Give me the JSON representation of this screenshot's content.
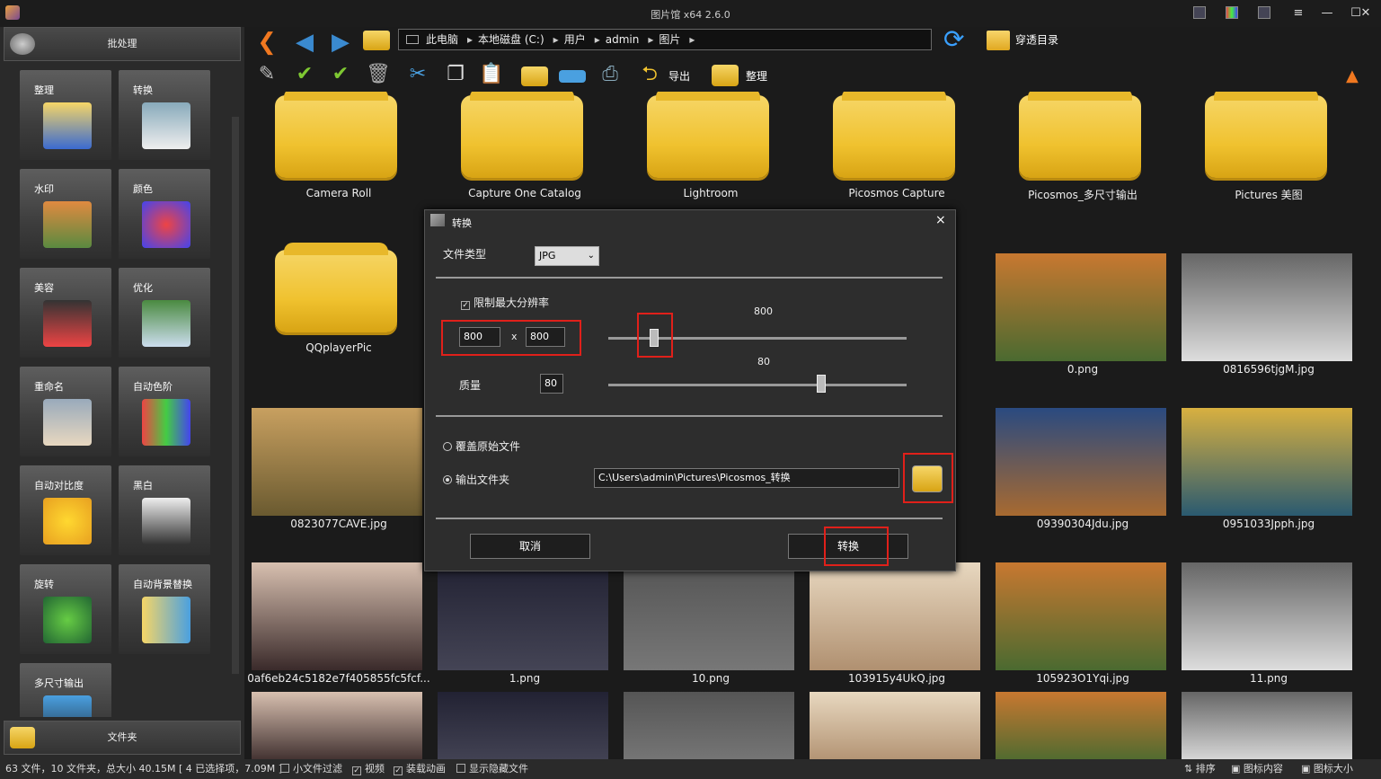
{
  "window": {
    "title": "图片馆 x64 2.6.0",
    "minimize": "—",
    "maximize": "☐",
    "close": "✕"
  },
  "sidebar": {
    "header": "批处理",
    "footer": "文件夹",
    "tiles": [
      {
        "label": "整理",
        "icon": "organize-icon"
      },
      {
        "label": "转换",
        "icon": "convert-icon"
      },
      {
        "label": "水印",
        "icon": "watermark-icon"
      },
      {
        "label": "颜色",
        "icon": "color-icon"
      },
      {
        "label": "美容",
        "icon": "beauty-icon"
      },
      {
        "label": "优化",
        "icon": "optimize-icon"
      },
      {
        "label": "重命名",
        "icon": "rename-icon"
      },
      {
        "label": "自动色阶",
        "icon": "auto-levels-icon"
      },
      {
        "label": "自动对比度",
        "icon": "auto-contrast-icon"
      },
      {
        "label": "黑白",
        "icon": "black-white-icon"
      },
      {
        "label": "旋转",
        "icon": "rotate-icon"
      },
      {
        "label": "自动背景替换",
        "icon": "background-replace-icon"
      },
      {
        "label": "多尺寸输出",
        "icon": "multi-size-icon"
      }
    ]
  },
  "address": {
    "crumbs": [
      "此电脑",
      "本地磁盘 (C:)",
      "用户",
      "admin",
      "图片"
    ],
    "separator": "▸",
    "penetrate_label": "穿透目录"
  },
  "toolbar": {
    "export_label": "导出",
    "organize_label": "整理"
  },
  "grid": [
    {
      "name": "Camera Roll",
      "kind": "folder"
    },
    {
      "name": "Capture One Catalog",
      "kind": "folder"
    },
    {
      "name": "Lightroom",
      "kind": "folder"
    },
    {
      "name": "Picosmos Capture",
      "kind": "folder"
    },
    {
      "name": "Picosmos_多尺寸输出",
      "kind": "folder"
    },
    {
      "name": "Pictures 美图",
      "kind": "folder"
    },
    {
      "name": "QQplayerPic",
      "kind": "folder"
    },
    {
      "name": "0.png",
      "kind": "image"
    },
    {
      "name": "0816596tjgM.jpg",
      "kind": "image"
    },
    {
      "name": "0823077CAVE.jpg",
      "kind": "image"
    },
    {
      "name": "09390304Jdu.jpg",
      "kind": "image"
    },
    {
      "name": "0951033Jpph.jpg",
      "kind": "image"
    },
    {
      "name": "0af6eb24c5182e7f405855fc5fcf...",
      "kind": "image"
    },
    {
      "name": "1.png",
      "kind": "image"
    },
    {
      "name": "10.png",
      "kind": "image"
    },
    {
      "name": "103915y4UkQ.jpg",
      "kind": "image"
    },
    {
      "name": "105923O1Yqi.jpg",
      "kind": "image"
    },
    {
      "name": "11.png",
      "kind": "image"
    }
  ],
  "dialog": {
    "title": "转换",
    "file_type_label": "文件类型",
    "file_type_value": "JPG",
    "limit_res_label": "限制最大分辨率",
    "width": "800",
    "x": "x",
    "height": "800",
    "res_slider_value": "800",
    "res_slider_level": 0.14,
    "quality_label": "质量",
    "quality_value": "80",
    "quality_slider_value": "80",
    "quality_slider_level": 0.7,
    "overwrite_label": "覆盖原始文件",
    "output_folder_label": "输出文件夹",
    "output_path": "C:\\Users\\admin\\Pictures\\Picosmos_转换",
    "cancel_label": "取消",
    "convert_label": "转换"
  },
  "status": {
    "summary": "63 文件，10 文件夹，总大小 40.15M [ 4 已选择项，7.09M ]",
    "filter_small": "小文件过滤",
    "video": "视频",
    "load_anim": "装载动画",
    "show_hidden": "显示隐藏文件",
    "sort": "排序",
    "icon_content": "图标内容",
    "icon_size": "图标大小"
  }
}
